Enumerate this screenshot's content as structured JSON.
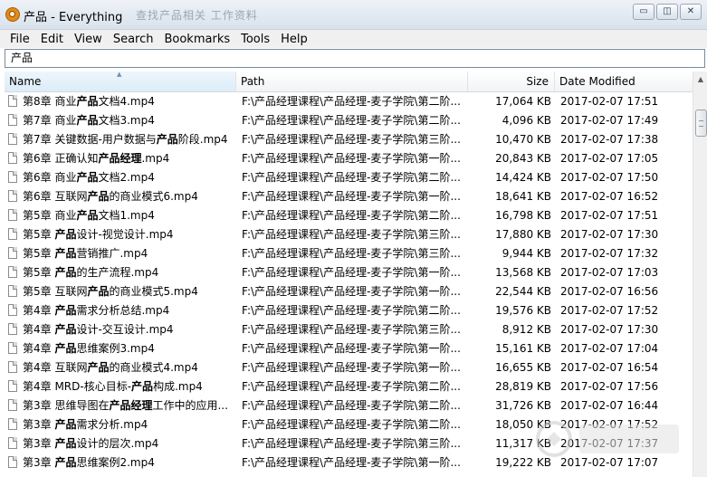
{
  "window": {
    "title": "产品 - Everything",
    "background_title": "查找产品相关  工作资料",
    "controls": {
      "minimize": "▭",
      "restore": "◫",
      "close": "✕"
    }
  },
  "menu": {
    "items": [
      "File",
      "Edit",
      "View",
      "Search",
      "Bookmarks",
      "Tools",
      "Help"
    ]
  },
  "search": {
    "value": "产品"
  },
  "columns": {
    "name": "Name",
    "path": "Path",
    "size": "Size",
    "date": "Date Modified"
  },
  "rows": [
    {
      "pre": "第8章 商业",
      "hl": "产品",
      "post": "文档4.mp4",
      "path": "F:\\产品经理课程\\产品经理-麦子学院\\第二阶...",
      "size": "17,064 KB",
      "date": "2017-02-07 17:51"
    },
    {
      "pre": "第7章 商业",
      "hl": "产品",
      "post": "文档3.mp4",
      "path": "F:\\产品经理课程\\产品经理-麦子学院\\第二阶...",
      "size": "4,096 KB",
      "date": "2017-02-07 17:49"
    },
    {
      "pre": "第7章 关键数据-用户数据与",
      "hl": "产品",
      "post": "阶段.mp4",
      "path": "F:\\产品经理课程\\产品经理-麦子学院\\第三阶...",
      "size": "10,470 KB",
      "date": "2017-02-07 17:38"
    },
    {
      "pre": "第6章 正确认知",
      "hl": "产品经理",
      "post": ".mp4",
      "path": "F:\\产品经理课程\\产品经理-麦子学院\\第一阶...",
      "size": "20,843 KB",
      "date": "2017-02-07 17:05"
    },
    {
      "pre": "第6章 商业",
      "hl": "产品",
      "post": "文档2.mp4",
      "path": "F:\\产品经理课程\\产品经理-麦子学院\\第二阶...",
      "size": "14,424 KB",
      "date": "2017-02-07 17:50"
    },
    {
      "pre": "第6章 互联网",
      "hl": "产品",
      "post": "的商业模式6.mp4",
      "path": "F:\\产品经理课程\\产品经理-麦子学院\\第一阶...",
      "size": "18,641 KB",
      "date": "2017-02-07 16:52"
    },
    {
      "pre": "第5章 商业",
      "hl": "产品",
      "post": "文档1.mp4",
      "path": "F:\\产品经理课程\\产品经理-麦子学院\\第二阶...",
      "size": "16,798 KB",
      "date": "2017-02-07 17:51"
    },
    {
      "pre": "第5章 ",
      "hl": "产品",
      "post": "设计-视觉设计.mp4",
      "path": "F:\\产品经理课程\\产品经理-麦子学院\\第三阶...",
      "size": "17,880 KB",
      "date": "2017-02-07 17:30"
    },
    {
      "pre": "第5章 ",
      "hl": "产品",
      "post": "营销推广.mp4",
      "path": "F:\\产品经理课程\\产品经理-麦子学院\\第三阶...",
      "size": "9,944 KB",
      "date": "2017-02-07 17:32"
    },
    {
      "pre": "第5章 ",
      "hl": "产品",
      "post": "的生产流程.mp4",
      "path": "F:\\产品经理课程\\产品经理-麦子学院\\第一阶...",
      "size": "13,568 KB",
      "date": "2017-02-07 17:03"
    },
    {
      "pre": "第5章 互联网",
      "hl": "产品",
      "post": "的商业模式5.mp4",
      "path": "F:\\产品经理课程\\产品经理-麦子学院\\第一阶...",
      "size": "22,544 KB",
      "date": "2017-02-07 16:56"
    },
    {
      "pre": "第4章 ",
      "hl": "产品",
      "post": "需求分析总结.mp4",
      "path": "F:\\产品经理课程\\产品经理-麦子学院\\第二阶...",
      "size": "19,576 KB",
      "date": "2017-02-07 17:52"
    },
    {
      "pre": "第4章 ",
      "hl": "产品",
      "post": "设计-交互设计.mp4",
      "path": "F:\\产品经理课程\\产品经理-麦子学院\\第三阶...",
      "size": "8,912 KB",
      "date": "2017-02-07 17:30"
    },
    {
      "pre": "第4章 ",
      "hl": "产品",
      "post": "思维案例3.mp4",
      "path": "F:\\产品经理课程\\产品经理-麦子学院\\第一阶...",
      "size": "15,161 KB",
      "date": "2017-02-07 17:04"
    },
    {
      "pre": "第4章 互联网",
      "hl": "产品",
      "post": "的商业模式4.mp4",
      "path": "F:\\产品经理课程\\产品经理-麦子学院\\第一阶...",
      "size": "16,655 KB",
      "date": "2017-02-07 16:54"
    },
    {
      "pre": "第4章 MRD-核心目标-",
      "hl": "产品",
      "post": "构成.mp4",
      "path": "F:\\产品经理课程\\产品经理-麦子学院\\第二阶...",
      "size": "28,819 KB",
      "date": "2017-02-07 17:56"
    },
    {
      "pre": "第3章 思维导图在",
      "hl": "产品经理",
      "post": "工作中的应用...",
      "path": "F:\\产品经理课程\\产品经理-麦子学院\\第二阶...",
      "size": "31,726 KB",
      "date": "2017-02-07 16:44"
    },
    {
      "pre": "第3章 ",
      "hl": "产品",
      "post": "需求分析.mp4",
      "path": "F:\\产品经理课程\\产品经理-麦子学院\\第二阶...",
      "size": "18,050 KB",
      "date": "2017-02-07 17:52"
    },
    {
      "pre": "第3章 ",
      "hl": "产品",
      "post": "设计的层次.mp4",
      "path": "F:\\产品经理课程\\产品经理-麦子学院\\第三阶...",
      "size": "11,317 KB",
      "date": "2017-02-07 17:37"
    },
    {
      "pre": "第3章 ",
      "hl": "产品",
      "post": "思维案例2.mp4",
      "path": "F:\\产品经理课程\\产品经理-麦子学院\\第一阶...",
      "size": "19,222 KB",
      "date": "2017-02-07 17:07"
    }
  ]
}
